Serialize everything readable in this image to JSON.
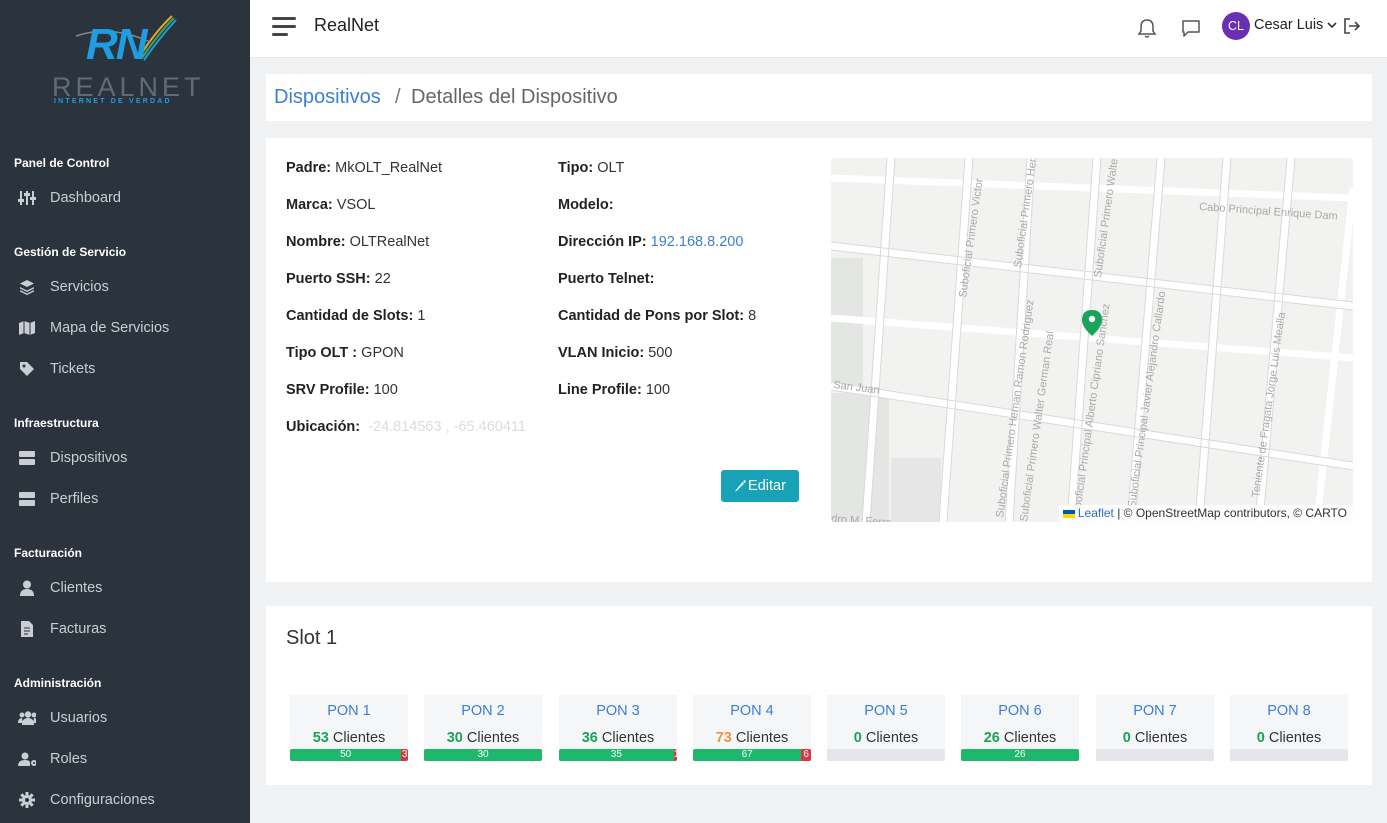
{
  "sidebar": {
    "logo": {
      "mark": "RN",
      "word": "REALNET",
      "tagline": "INTERNET DE VERDAD"
    },
    "sections": [
      {
        "title": "Panel de Control",
        "items": [
          {
            "label": "Dashboard",
            "icon": "sliders-icon"
          }
        ]
      },
      {
        "title": "Gestión de Servicio",
        "items": [
          {
            "label": "Servicios",
            "icon": "layers-icon"
          },
          {
            "label": "Mapa de Servicios",
            "icon": "map-icon"
          },
          {
            "label": "Tickets",
            "icon": "tags-icon"
          }
        ]
      },
      {
        "title": "Infraestructura",
        "items": [
          {
            "label": "Dispositivos",
            "icon": "server-icon"
          },
          {
            "label": "Perfiles",
            "icon": "server-icon"
          }
        ]
      },
      {
        "title": "Facturación",
        "items": [
          {
            "label": "Clientes",
            "icon": "user-icon"
          },
          {
            "label": "Facturas",
            "icon": "file-icon"
          }
        ]
      },
      {
        "title": "Administración",
        "items": [
          {
            "label": "Usuarios",
            "icon": "users-icon"
          },
          {
            "label": "Roles",
            "icon": "user-cog-icon"
          },
          {
            "label": "Configuraciones",
            "icon": "gear-icon"
          }
        ]
      }
    ]
  },
  "topbar": {
    "app_title": "RealNet",
    "user": {
      "initials": "CL",
      "name": "Cesar Luis"
    },
    "colors": {
      "avatar": "#6a2fb3"
    }
  },
  "breadcrumb": {
    "parent": "Dispositivos",
    "separator": "/",
    "current": "Detalles del Dispositivo"
  },
  "device": {
    "left": [
      {
        "label": "Padre:",
        "value": "MkOLT_RealNet"
      },
      {
        "label": "Marca:",
        "value": "VSOL"
      },
      {
        "label": "Nombre:",
        "value": "OLTRealNet"
      },
      {
        "label": "Puerto SSH:",
        "value": "22"
      },
      {
        "label": "Cantidad de Slots:",
        "value": "1"
      },
      {
        "label": "Tipo OLT :",
        "value": "GPON"
      },
      {
        "label": "SRV Profile:",
        "value": "100"
      },
      {
        "label": "Ubicación:",
        "value": "-24.814563 , -65.460411"
      }
    ],
    "right": [
      {
        "label": "Tipo:",
        "value": "OLT"
      },
      {
        "label": "Modelo:",
        "value": ""
      },
      {
        "label": "Dirección IP:",
        "value": "192.168.8.200"
      },
      {
        "label": "Puerto Telnet:",
        "value": ""
      },
      {
        "label": "Cantidad de Pons por Slot:",
        "value": "8"
      },
      {
        "label": "VLAN Inicio:",
        "value": "500"
      },
      {
        "label": "Line Profile:",
        "value": "100"
      }
    ],
    "edit_label": "Editar"
  },
  "map": {
    "streets": [
      "Cabo Principal Enrique Dam",
      "San Juan",
      "Suboficial Primero Victor",
      "Suboficial Primero Hern",
      "Suboficial Primero Walte",
      "Suboficial Primero Hernan Ramon Rodriguez",
      "Suboficial Primero Walter German Real",
      "Suboficial Principal Alberto Cipriano Sanchez",
      "Suboficial Principal Javier Alejandro Callardo",
      "Teniente de Fragata Jorge Luis Mealla",
      "dro M. Ferre"
    ],
    "attribution": {
      "leaflet": "Leaflet",
      "rest": "| © OpenStreetMap contributors, © CARTO"
    }
  },
  "slot": {
    "title": "Slot 1",
    "clients_label": "Clientes",
    "pons": [
      {
        "name": "PON 1",
        "count": 53,
        "count_color": "#1aa35a",
        "ok": 50,
        "bad": 3
      },
      {
        "name": "PON 2",
        "count": 30,
        "count_color": "#1aa35a",
        "ok": 30,
        "bad": 0
      },
      {
        "name": "PON 3",
        "count": 36,
        "count_color": "#1aa35a",
        "ok": 35,
        "bad": 1
      },
      {
        "name": "PON 4",
        "count": 73,
        "count_color": "#f0943b",
        "ok": 67,
        "bad": 6
      },
      {
        "name": "PON 5",
        "count": 0,
        "count_color": "#1aa35a",
        "ok": 0,
        "bad": 0
      },
      {
        "name": "PON 6",
        "count": 26,
        "count_color": "#1aa35a",
        "ok": 26,
        "bad": 0
      },
      {
        "name": "PON 7",
        "count": 0,
        "count_color": "#1aa35a",
        "ok": 0,
        "bad": 0
      },
      {
        "name": "PON 8",
        "count": 0,
        "count_color": "#1aa35a",
        "ok": 0,
        "bad": 0
      }
    ],
    "colors": {
      "ok": "#1db86c",
      "bad": "#dc3545"
    }
  }
}
